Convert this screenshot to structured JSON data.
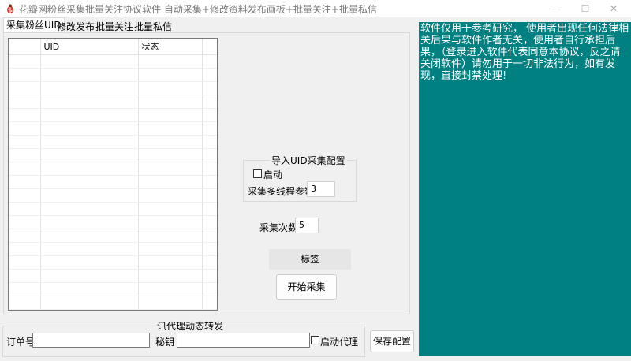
{
  "window": {
    "title": "花瓣网粉丝采集批量关注协议软件 自动采集+修改资料发布画板+批量关注+批量私信",
    "minimize_glyph": "—",
    "maximize_glyph": "☐",
    "close_glyph": "✕"
  },
  "tabs": [
    {
      "label": "采集粉丝UID",
      "active": true
    },
    {
      "label": "修改发布",
      "active": false
    },
    {
      "label": "批量关注",
      "active": false
    },
    {
      "label": "批量私信",
      "active": false
    }
  ],
  "grid": {
    "columns": [
      "UID",
      "状态"
    ],
    "rows": []
  },
  "import_group": {
    "title": "导入UID采集配置",
    "enable_label": "启动",
    "enable_checked": false,
    "threads_label": "采集多线程参数",
    "threads_value": "3"
  },
  "collect_count": {
    "label": "采集次数",
    "value": "5"
  },
  "tag_label": "标签",
  "start_button": "开始采集",
  "proxy": {
    "title": "讯代理动态转发",
    "order_label": "订单号",
    "order_value": "",
    "secret_label": "秘钥",
    "secret_value": "",
    "enable_label": "启动代理",
    "enable_checked": false
  },
  "save_button": "保存配置",
  "notice_text": "软件仅用于参考研究， 使用者出现任何法律相关后果与软件作者无关，使用者自行承担后果，（登录进入软件代表同意本协议，反之请关闭软件）请勿用于一切非法行为，如有发现，直接封禁处理!",
  "colors": {
    "notice_bg": "#008080",
    "notice_text": "#ffffff",
    "window_bg": "#f0f0f0"
  },
  "icons": {
    "app": "bug-icon"
  }
}
